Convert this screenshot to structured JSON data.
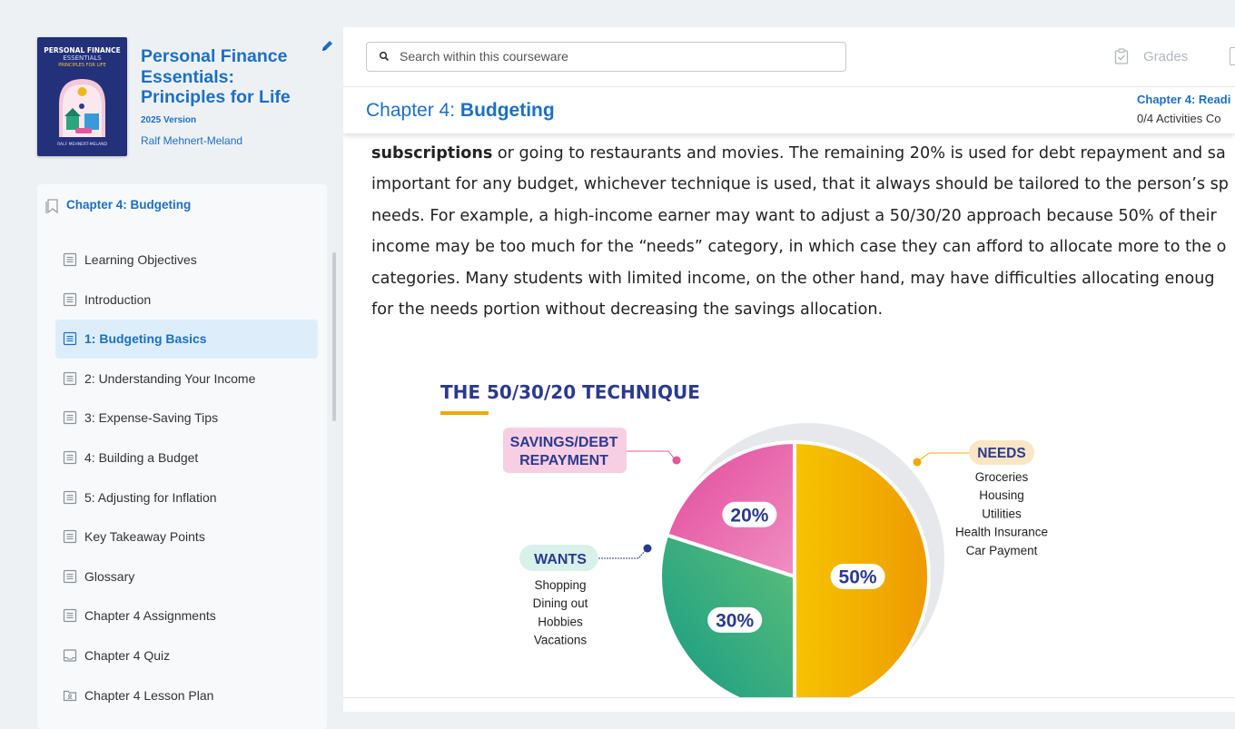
{
  "book": {
    "cover": {
      "title_line1": "PERSONAL FINANCE",
      "title_line2": "ESSENTIALS",
      "subtitle": "PRINCIPLES FOR LIFE",
      "author": "RALF MEHNERT-MELAND"
    },
    "title": "Personal Finance Essentials: Principles for Life",
    "version": "2025 Version",
    "author": "Ralf Mehnert-Meland"
  },
  "toc": {
    "chapter_title": "Chapter 4: Budgeting",
    "items": [
      {
        "label": "Learning Objectives",
        "icon": "page-icon",
        "active": false
      },
      {
        "label": "Introduction",
        "icon": "page-icon",
        "active": false
      },
      {
        "label": "1: Budgeting Basics",
        "icon": "page-icon",
        "active": true
      },
      {
        "label": "2: Understanding Your Income",
        "icon": "page-icon",
        "active": false
      },
      {
        "label": "3: Expense-Saving Tips",
        "icon": "page-icon",
        "active": false
      },
      {
        "label": "4: Building a Budget",
        "icon": "page-icon",
        "active": false
      },
      {
        "label": "5: Adjusting for Inflation",
        "icon": "page-icon",
        "active": false
      },
      {
        "label": "Key Takeaway Points",
        "icon": "page-icon",
        "active": false
      },
      {
        "label": "Glossary",
        "icon": "page-icon",
        "active": false
      },
      {
        "label": "Chapter 4 Assignments",
        "icon": "page-icon",
        "active": false
      },
      {
        "label": "Chapter 4 Quiz",
        "icon": "inbox-icon",
        "active": false
      },
      {
        "label": "Chapter 4 Lesson Plan",
        "icon": "folder-icon",
        "active": false
      }
    ]
  },
  "search": {
    "placeholder": "Search within this courseware"
  },
  "header": {
    "grades_label": "Grades",
    "chapter_prefix": "Chapter 4: ",
    "chapter_name": "Budgeting",
    "right_title": "Chapter 4: Readi",
    "right_subtitle": "0/4 Activities Co"
  },
  "content": {
    "line1_bold": "subscriptions",
    "line1_rest": " or going to restaurants and movies. The remaining 20% is used for debt repayment and sa",
    "line2": "important for any budget, whichever technique is used, that it always should be tailored to the person’s sp",
    "line3": "needs. For example, a high-income earner may want to adjust a 50/30/20 approach because 50% of their",
    "line4": "income may be too much for the “needs” category, in which case they can afford to allocate more to the o",
    "line5": "categories. Many students with limited income, on the other hand, may have difficulties allocating enoug",
    "line6": "for the needs portion without decreasing the savings allocation."
  },
  "figure": {
    "title": "THE 50/30/20 TECHNIQUE",
    "slices": [
      {
        "name": "NEEDS",
        "percent": 50,
        "label": "50%",
        "color": "#f2a900",
        "items": [
          "Groceries",
          "Housing",
          "Utilities",
          "Health Insurance",
          "Car Payment"
        ]
      },
      {
        "name": "WANTS",
        "percent": 30,
        "label": "30%",
        "color": "#2aa57e",
        "items": [
          "Shopping",
          "Dining out",
          "Hobbies",
          "Vacations"
        ]
      },
      {
        "name": "SAVINGS/DEBT REPAYMENT",
        "name_line1": "SAVINGS/DEBT",
        "name_line2": "REPAYMENT",
        "percent": 20,
        "label": "20%",
        "color": "#e0579a",
        "items": []
      }
    ]
  },
  "colors": {
    "accent": "#1c6fc4",
    "active_bg": "#ddeefa",
    "figure_title": "#2b3a8f"
  }
}
